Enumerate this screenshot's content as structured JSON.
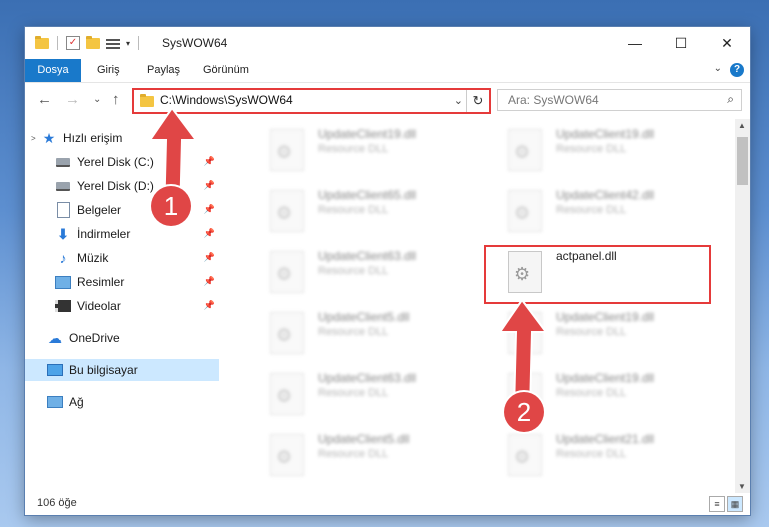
{
  "window": {
    "title": "SysWOW64",
    "minimize": "—",
    "maximize": "☐",
    "close": "✕"
  },
  "ribbon": {
    "tabs": [
      "Dosya",
      "Giriş",
      "Paylaş",
      "Görünüm"
    ],
    "collapse": "⌄",
    "help": "?"
  },
  "nav": {
    "back": "←",
    "forward": "→",
    "recent": "⌄",
    "up": "↑",
    "address": "C:\\Windows\\SysWOW64",
    "address_dropdown": "⌄",
    "refresh": "↻",
    "search_placeholder": "Ara: SysWOW64",
    "search_icon": "⌕"
  },
  "sidebar": {
    "items": [
      {
        "label": "Hızlı erişim",
        "icon": "star-icon",
        "pinned": false
      },
      {
        "label": "Yerel Disk (C:)",
        "icon": "drive-icon",
        "pinned": true
      },
      {
        "label": "Yerel Disk (D:)",
        "icon": "drive-icon",
        "pinned": true
      },
      {
        "label": "Belgeler",
        "icon": "document-icon",
        "pinned": true
      },
      {
        "label": "İndirmeler",
        "icon": "download-icon",
        "pinned": true
      },
      {
        "label": "Müzik",
        "icon": "music-icon",
        "pinned": true
      },
      {
        "label": "Resimler",
        "icon": "pictures-icon",
        "pinned": true
      },
      {
        "label": "Videolar",
        "icon": "video-icon",
        "pinned": true
      },
      {
        "label": "OneDrive",
        "icon": "cloud-icon",
        "pinned": false
      },
      {
        "label": "Bu bilgisayar",
        "icon": "computer-icon",
        "pinned": false,
        "selected": true
      },
      {
        "label": "Ağ",
        "icon": "network-icon",
        "pinned": false
      }
    ],
    "pin_glyph": "📌"
  },
  "files": [
    {
      "name": "UpdateClient19.dll",
      "desc": "Resource DLL",
      "blurred": true
    },
    {
      "name": "UpdateClient19.dll",
      "desc": "Resource DLL",
      "blurred": true
    },
    {
      "name": "UpdateClient65.dll",
      "desc": "Resource DLL",
      "blurred": true
    },
    {
      "name": "UpdateClient42.dll",
      "desc": "Resource DLL",
      "blurred": true
    },
    {
      "name": "UpdateClient63.dll",
      "desc": "Resource DLL",
      "blurred": true
    },
    {
      "name": "actpanel.dll",
      "desc": "",
      "blurred": false
    },
    {
      "name": "UpdateClient5.dll",
      "desc": "Resource DLL",
      "blurred": true
    },
    {
      "name": "UpdateClient19.dll",
      "desc": "Resource DLL",
      "blurred": true
    },
    {
      "name": "UpdateClient63.dll",
      "desc": "Resource DLL",
      "blurred": true
    },
    {
      "name": "UpdateClient19.dll",
      "desc": "Resource DLL",
      "blurred": true
    },
    {
      "name": "UpdateClient5.dll",
      "desc": "Resource DLL",
      "blurred": true
    },
    {
      "name": "UpdateClient21.dll",
      "desc": "Resource DLL",
      "blurred": true
    }
  ],
  "status": {
    "count": "106 öğe"
  },
  "annotations": {
    "step1": "1",
    "step2": "2",
    "color": "#e04646"
  }
}
